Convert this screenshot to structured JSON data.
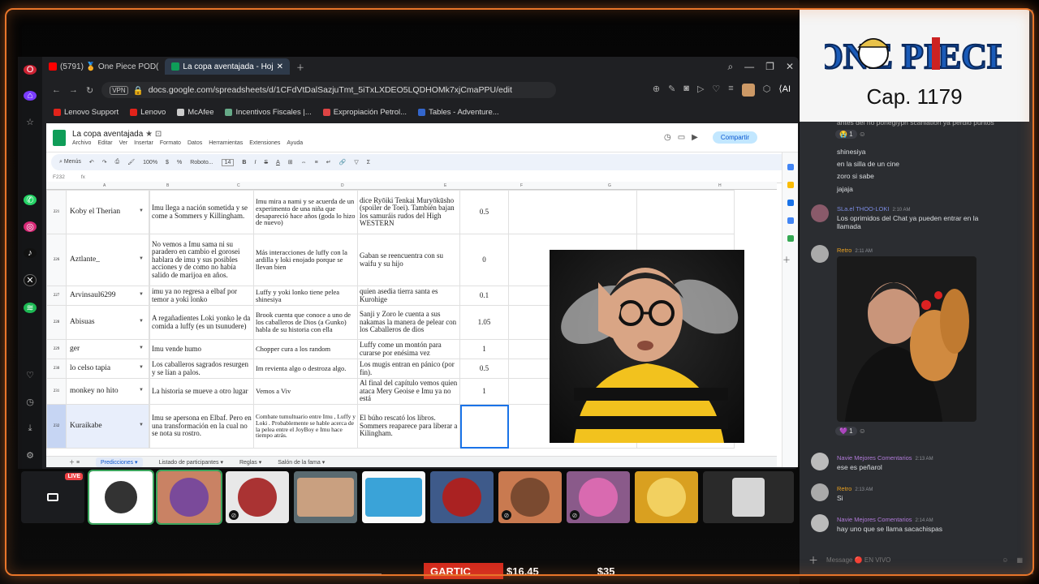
{
  "browser": {
    "tabs": [
      {
        "label": "(5791) 🏅 One Piece POD(",
        "active": false
      },
      {
        "label": "La copa aventajada - Hoj",
        "active": true
      }
    ],
    "url": "docs.google.com/spreadsheets/d/1CFdVtDalSazjuTmt_5iTxLXDEO5LQDHOMk7xjCmaPPU/edit",
    "vpn_label": "VPN",
    "bookmarks": [
      "Lenovo Support",
      "Lenovo",
      "McAfee",
      "Incentivos Fiscales |...",
      "Expropiación Petrol...",
      "Tables - Adventure..."
    ]
  },
  "sheet": {
    "title": "La copa aventajada",
    "menu": [
      "Archivo",
      "Editar",
      "Ver",
      "Insertar",
      "Formato",
      "Datos",
      "Herramientas",
      "Extensiones",
      "Ayuda"
    ],
    "share_label": "Compartir",
    "toolbar": {
      "menus": "Menús",
      "zoom": "100%",
      "font": "Roboto...",
      "size": "14"
    },
    "cell_ref": "F232",
    "col_letters": [
      "A",
      "B",
      "C",
      "D",
      "E",
      "F",
      "G",
      "H"
    ],
    "rows": [
      {
        "n": "221",
        "name": "Koby el Therian",
        "cap": "1179",
        "c": "Imu llega a nación sometida y se come a Sommers y Killingham.",
        "d": "Imu mira a nami y se acuerda de un experimento de una niña que desapareció hace años (goda lo hizo de nuevo)",
        "e": "dice Ryōiki Tenkai Muryōkūsho (spoiler de Toei). También bajan los samuráis rudos del High WESTERN",
        "f": "0.5"
      },
      {
        "n": "226",
        "name": "Aztlante_",
        "cap": "1179",
        "c": "No vemos a Imu sama ni su paradero en cambio el gorosei hablara de imu y sus posibles acciones y de como no había salido de marijoa en años.",
        "d": "Más interacciones de luffy con la ardilla y loki enojado porque se llevan bien",
        "e": "Gaban se reencuentra con su waifu y su hijo",
        "f": "0"
      },
      {
        "n": "227",
        "name": "Arvinsaul6299",
        "cap": "1179",
        "c": "imu ya no regresa a elbaf por temor a yoki lonko",
        "d": "Luffy y yoki lonko tiene pelea shinesiya",
        "e": "quien asedia tierra santa es Kurohige",
        "f": "0.1"
      },
      {
        "n": "228",
        "name": "Abisuas",
        "cap": "1179",
        "c": "A regañadientes Loki yonko le da comida a luffy (es un tsunudere)",
        "d": "Brook cuenta que conoce a uno de los caballeros de Dios (a Gunko) habla de su historia  con ella",
        "e": "Sanji y Zoro le cuenta a sus nakamas la manera de pelear con los Caballeros de dios",
        "f": "1.05"
      },
      {
        "n": "229",
        "name": "ger",
        "cap": "1179",
        "c": "Imu vende humo",
        "d": "Chopper cura a los random",
        "e": "Luffy come un montón para curarse por enésima vez",
        "f": "1"
      },
      {
        "n": "230",
        "name": "lo celso tapia",
        "cap": "1179",
        "c": "Los caballeros sagrados resurgen y se lían a palos.",
        "d": "Im revienta algo o destroza algo.",
        "e": "Los mugis entran en pánico (por fin).",
        "f": "0.5"
      },
      {
        "n": "231",
        "name": "monkey no hito",
        "cap": "1179",
        "c": "La historia se mueve a otro lugar",
        "d": "Vemos a Viv",
        "e": "Al final del capítulo vemos quien ataca Mery Geoise e Imu ya no está",
        "f": "1"
      },
      {
        "n": "232",
        "name": "Kuraikabe",
        "cap": "1179",
        "c": "Imu se apersona en Elbaf. Pero en una transformación en la cual no se nota su rostro.",
        "d": "Combate tumultuario entre Imu , Luffy y Loki . Probablemente se hable acerca de la pelea entre el JoyBoy e Imu hace tiempo atrás.",
        "e": "El búho rescató  los libros. Sommers reaparece para liberar a  Kilingham.",
        "f": ""
      }
    ],
    "sheet_tabs": [
      "Predicciones",
      "Listado de participantes",
      "Reglas",
      "Salón de la fama"
    ]
  },
  "stream": {
    "live_label": "LIVE",
    "ticker_label": "GARTIC",
    "ticker_value_1": "$16.45",
    "ticker_value_2": "$35"
  },
  "chat": {
    "banner_caption": "Cap. 1179",
    "messages": [
      {
        "text": "antes del no poneglyph scanlation ya perdió puntos",
        "react": "😭 1"
      },
      {
        "text": "shinesiya"
      },
      {
        "text": "en la silla de un cine"
      },
      {
        "text": "zoro si sabe"
      },
      {
        "text": "jajaja"
      },
      {
        "author": "SLa.el THOO-LOKI",
        "time": "2:10 AM",
        "text": "Los oprimidos del Chat ya pueden entrar en la llamada"
      },
      {
        "author": "Retro",
        "time": "2:11 AM",
        "react": "💜 1"
      },
      {
        "author": "Navie Mejores Comentarios",
        "time": "2:13 AM",
        "text": "ese es peñarol"
      },
      {
        "author": "Retro",
        "time": "2:13 AM",
        "text": "Si"
      },
      {
        "author": "Navie Mejores Comentarios",
        "time": "2:14 AM",
        "text": "hay uno que se llama sacachispas"
      }
    ],
    "input_placeholder": "Message 🔴 EN VIVO"
  },
  "colors": {
    "accent": "#e8752a",
    "chat_bg": "#2b2d31",
    "sheets_green": "#0f9d58",
    "gartic_red": "#d32a1e"
  }
}
